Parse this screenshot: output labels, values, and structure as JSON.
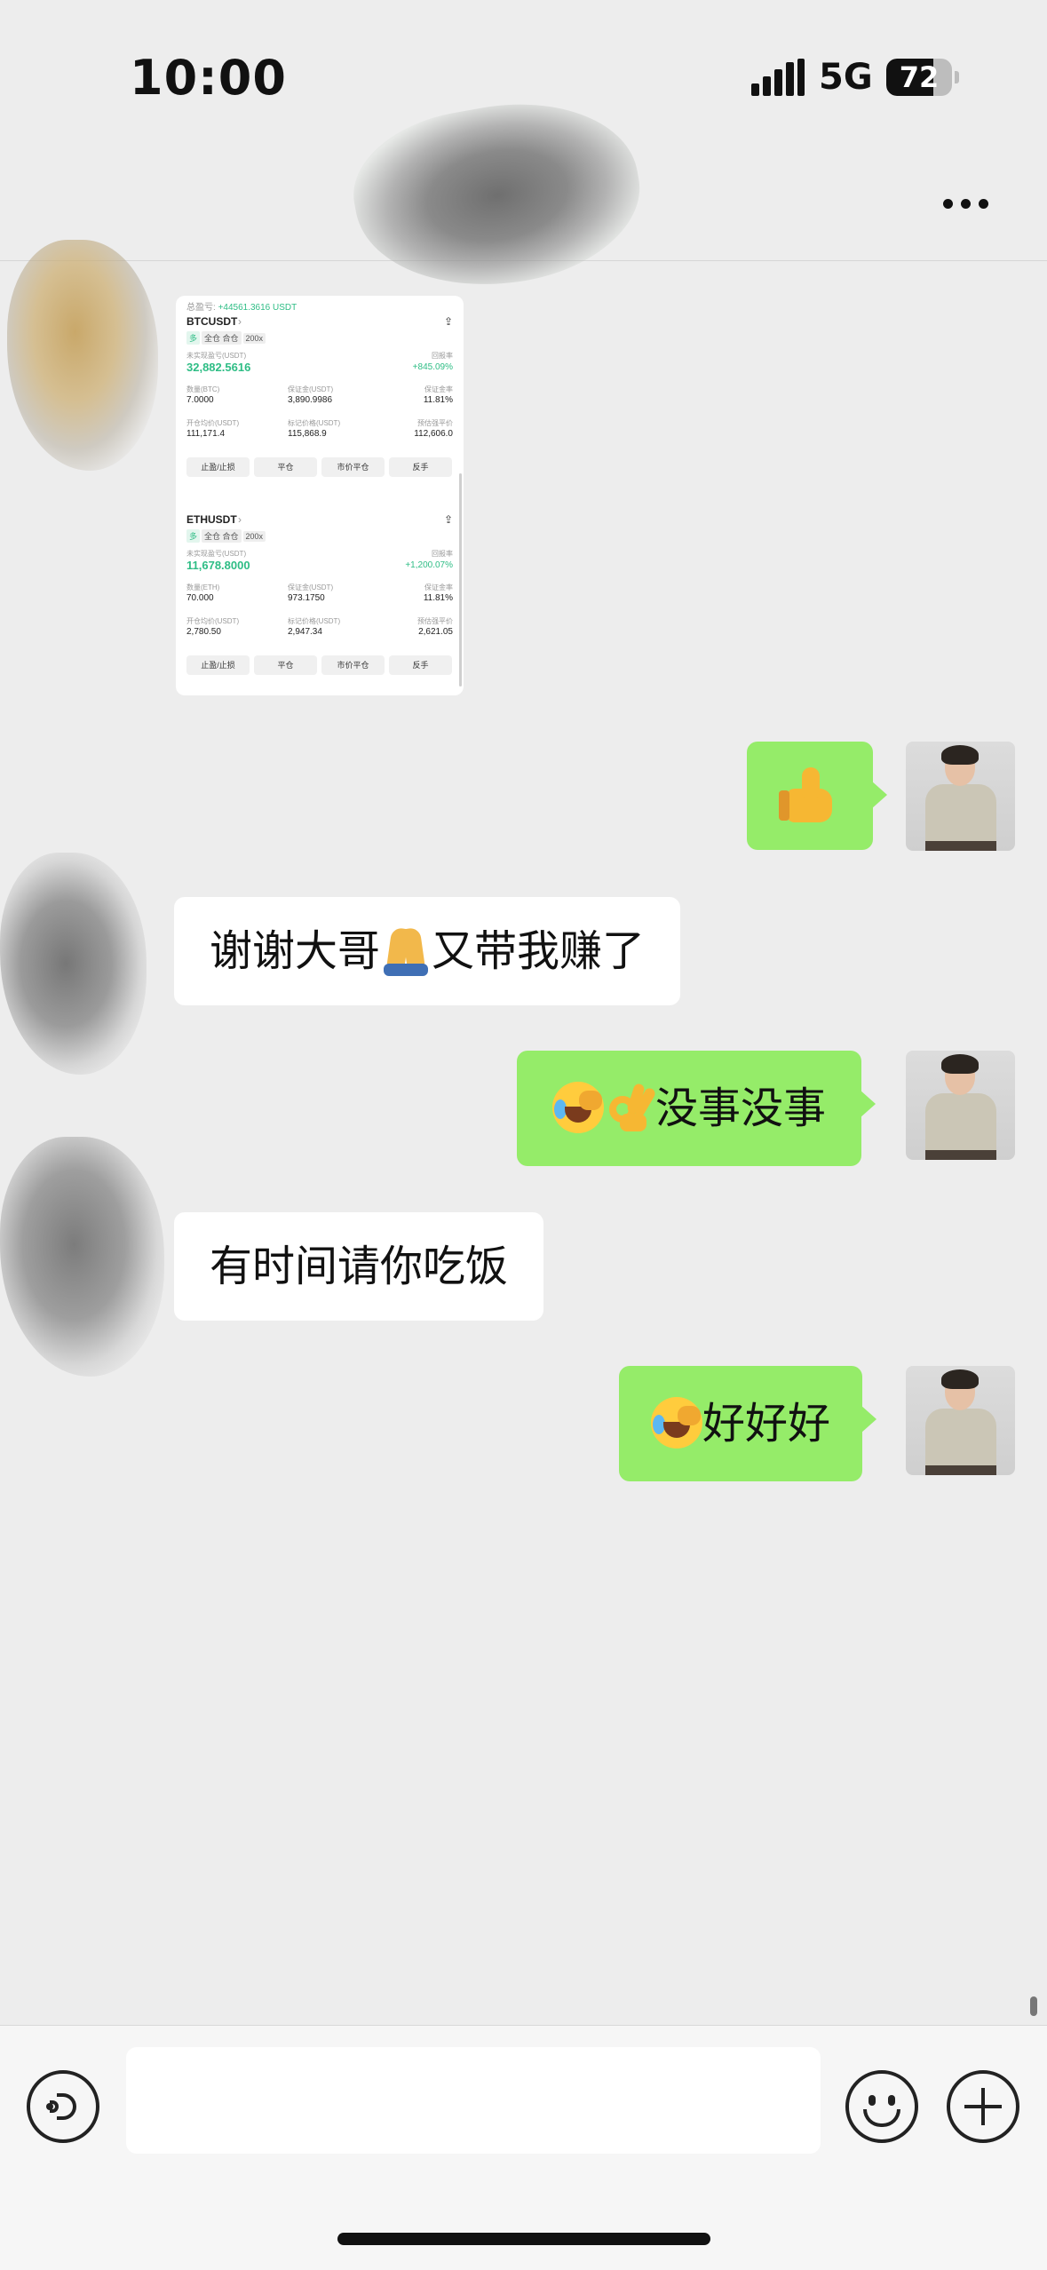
{
  "status_bar": {
    "time": "10:00",
    "network": "5G",
    "battery": "72",
    "battery_level": 0.72
  },
  "header": {
    "more_icon": "more-dots-icon"
  },
  "screenshot": {
    "total_pnl_label": "总盈亏",
    "total_pnl_value": "+44561.3616 USDT",
    "positions": [
      {
        "symbol": "BTCUSDT",
        "tags": [
          "多",
          "全仓 合仓",
          "200x"
        ],
        "pnl_label": "未实现盈亏(USDT)",
        "roe_label": "回报率",
        "pnl": "32,882.5616",
        "roe": "+845.09%",
        "qty_label": "数量(BTC)",
        "margin_label": "保证金(USDT)",
        "margin_ratio_label": "保证金率",
        "qty": "7.0000",
        "margin": "3,890.9986",
        "margin_ratio": "11.81%",
        "entry_label": "开仓均价(USDT)",
        "mark_label": "标记价格(USDT)",
        "liq_label": "预估强平价",
        "entry": "111,171.4",
        "mark": "115,868.9",
        "liq": "112,606.0",
        "buttons": [
          "止盈/止损",
          "平仓",
          "市价平仓",
          "反手"
        ]
      },
      {
        "symbol": "ETHUSDT",
        "tags": [
          "多",
          "全仓 合仓",
          "200x"
        ],
        "pnl_label": "未实现盈亏(USDT)",
        "roe_label": "回报率",
        "pnl": "11,678.8000",
        "roe": "+1,200.07%",
        "qty_label": "数量(ETH)",
        "margin_label": "保证金(USDT)",
        "margin_ratio_label": "保证金率",
        "qty": "70.000",
        "margin": "973.1750",
        "margin_ratio": "11.81%",
        "entry_label": "开仓均价(USDT)",
        "mark_label": "标记价格(USDT)",
        "liq_label": "预估强平价",
        "entry": "2,780.50",
        "mark": "2,947.34",
        "liq": "2,621.05",
        "buttons": [
          "止盈/止损",
          "平仓",
          "市价平仓",
          "反手"
        ]
      }
    ]
  },
  "messages": [
    {
      "side": "out",
      "emoji": "thumbs-up",
      "text": ""
    },
    {
      "side": "in",
      "text_a": "谢谢大哥",
      "emoji": "folded-hands",
      "text_b": "又带我赚了"
    },
    {
      "side": "out",
      "emoji": [
        "rofl",
        "ok-hand"
      ],
      "text": "没事没事"
    },
    {
      "side": "in",
      "text": "有时间请你吃饭"
    },
    {
      "side": "out",
      "emoji": "rofl",
      "text": "好好好"
    }
  ],
  "input_bar": {
    "placeholder": "",
    "voice_icon": "voice-icon",
    "emoji_icon": "emoji-icon",
    "plus_icon": "plus-icon"
  },
  "colors": {
    "background": "#ededed",
    "outgoing_bubble": "#95ec69",
    "incoming_bubble": "#ffffff",
    "profit_green": "#2ebd85"
  }
}
